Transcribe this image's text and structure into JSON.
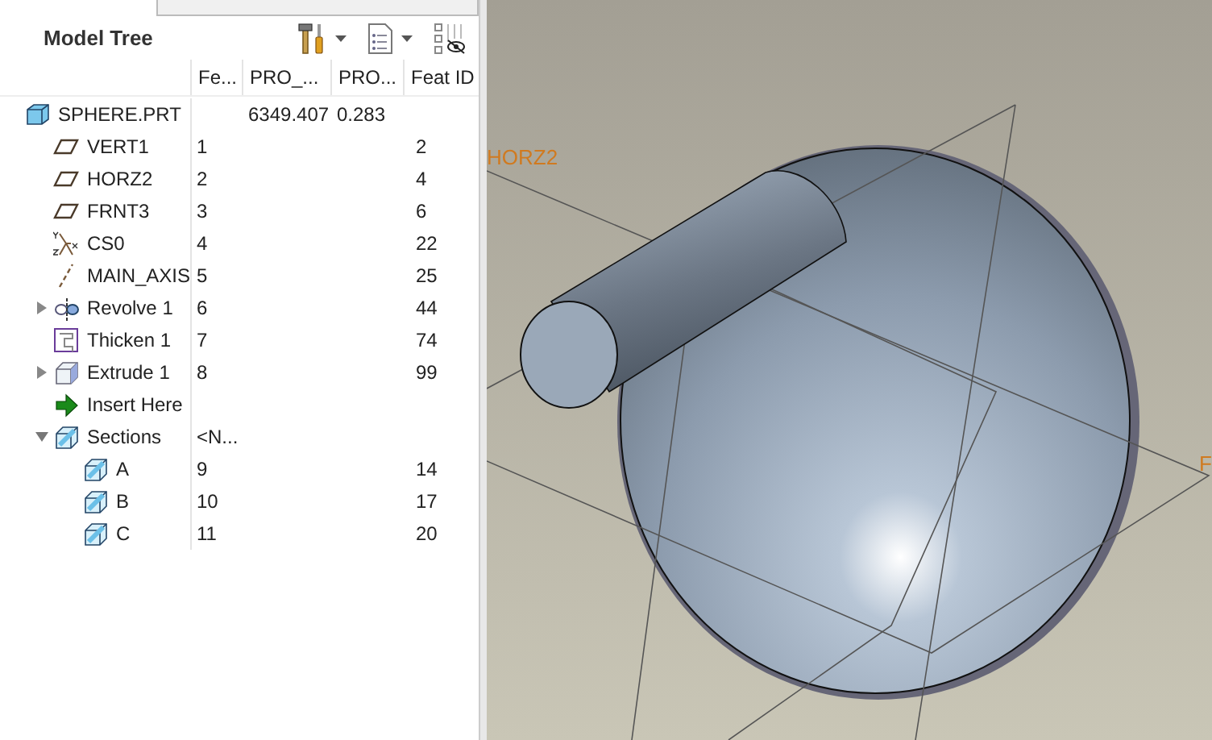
{
  "panel": {
    "title": "Model Tree"
  },
  "tree": {
    "columns": [
      "Fe...",
      "PRO_...",
      "PRO...",
      "Feat ID"
    ],
    "root": {
      "name": "SPHERE.PRT",
      "kind": "part",
      "cells": {
        "c1": "6349.407",
        "c2": "0.283"
      },
      "children": [
        {
          "name": "VERT1",
          "kind": "plane",
          "cells": {
            "c0": "1",
            "c3": "2"
          }
        },
        {
          "name": "HORZ2",
          "kind": "plane",
          "cells": {
            "c0": "2",
            "c3": "4"
          }
        },
        {
          "name": "FRNT3",
          "kind": "plane",
          "cells": {
            "c0": "3",
            "c3": "6"
          }
        },
        {
          "name": "CS0",
          "kind": "csys",
          "cells": {
            "c0": "4",
            "c3": "22"
          }
        },
        {
          "name": "MAIN_AXIS",
          "kind": "axis",
          "cells": {
            "c0": "5",
            "c3": "25"
          }
        },
        {
          "name": "Revolve 1",
          "kind": "revolve",
          "expanded": false,
          "cells": {
            "c0": "6",
            "c3": "44"
          }
        },
        {
          "name": "Thicken 1",
          "kind": "thicken",
          "cells": {
            "c0": "7",
            "c3": "74"
          }
        },
        {
          "name": "Extrude 1",
          "kind": "extrude",
          "expanded": false,
          "cells": {
            "c0": "8",
            "c3": "99"
          }
        },
        {
          "name": "Insert Here",
          "kind": "insert"
        },
        {
          "name": "Sections",
          "kind": "section",
          "expanded": true,
          "cells": {
            "c0": "<N..."
          },
          "children": [
            {
              "name": "A",
              "kind": "section",
              "cells": {
                "c0": "9",
                "c3": "14"
              }
            },
            {
              "name": "B",
              "kind": "section",
              "cells": {
                "c0": "10",
                "c3": "17"
              }
            },
            {
              "name": "C",
              "kind": "section",
              "cells": {
                "c0": "11",
                "c3": "20"
              }
            }
          ]
        }
      ]
    }
  },
  "viewport": {
    "labels": [
      "HORZ2",
      "F"
    ]
  }
}
